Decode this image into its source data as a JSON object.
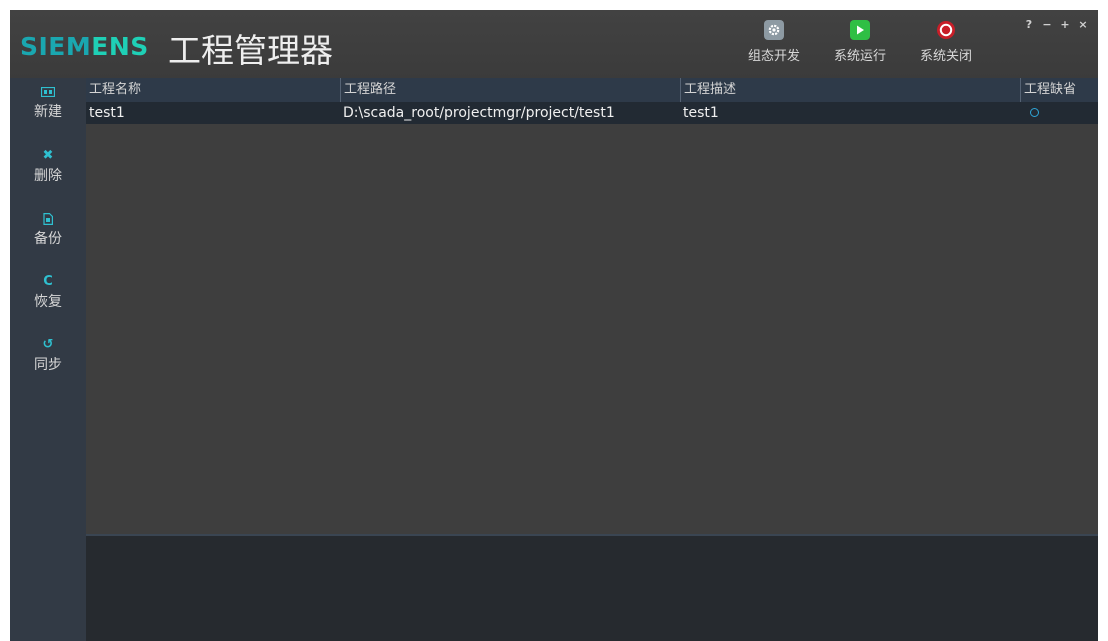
{
  "header": {
    "brand_part1": "SIEM",
    "brand_part2": "ENS",
    "title": "工程管理器"
  },
  "toolbar": {
    "config_label": "组态开发",
    "run_label": "系统运行",
    "stop_label": "系统关闭"
  },
  "window_controls": {
    "help": "?",
    "minimize": "−",
    "maximize": "+",
    "close": "×"
  },
  "sidebar": {
    "items": [
      {
        "label": "新建",
        "icon": "new-project-icon"
      },
      {
        "label": "删除",
        "icon": "delete-icon",
        "glyph": "✖"
      },
      {
        "label": "备份",
        "icon": "backup-icon"
      },
      {
        "label": "恢复",
        "icon": "restore-icon",
        "glyph": "C"
      },
      {
        "label": "同步",
        "icon": "sync-icon",
        "glyph": "↺"
      }
    ]
  },
  "table": {
    "columns": [
      "工程名称",
      "工程路径",
      "工程描述",
      "工程缺省"
    ],
    "rows": [
      {
        "name": "test1",
        "path": "D:\\scada_root/projectmgr/project/test1",
        "description": "test1",
        "default": true
      }
    ]
  },
  "colors": {
    "accent": "#1fd0b6",
    "run": "#2fbf44",
    "stop": "#d0202a",
    "sidebar_icon": "#2fc0d0"
  }
}
